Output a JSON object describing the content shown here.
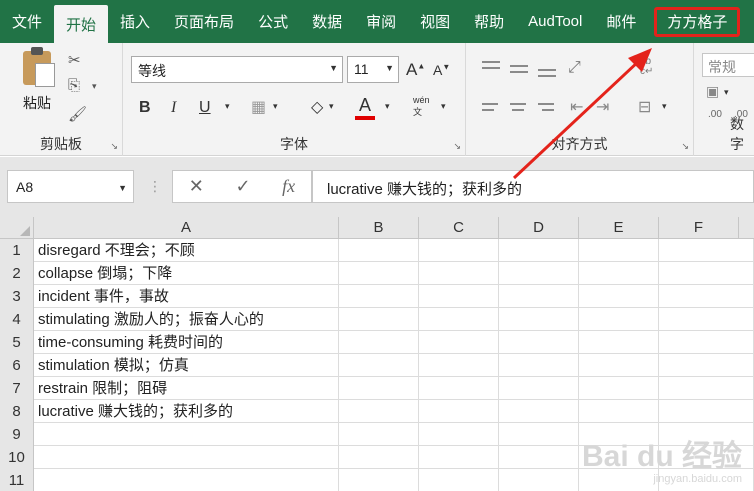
{
  "menu": {
    "tabs": [
      "文件",
      "开始",
      "插入",
      "页面布局",
      "公式",
      "数据",
      "审阅",
      "视图",
      "帮助",
      "AudTool",
      "邮件",
      "方方格子"
    ],
    "active_index": 1,
    "highlight_index": 11
  },
  "ribbon": {
    "clipboard": {
      "paste_label": "粘贴",
      "group_label": "剪贴板"
    },
    "font": {
      "font_name": "等线",
      "font_size": "11",
      "bold": "B",
      "italic": "I",
      "underline": "U",
      "font_color_glyph": "A",
      "phonetic": "wén",
      "grow": "A",
      "shrink": "A",
      "group_label": "字体"
    },
    "alignment": {
      "group_label": "对齐方式",
      "wrap_glyph": "ab\nc"
    },
    "number": {
      "format": "常规",
      "group_label": "数字",
      "decimal_inc": ".00",
      "decimal_dec": ".00"
    }
  },
  "formula_bar": {
    "name_box": "A8",
    "cancel_icon": "✕",
    "enter_icon": "✓",
    "fx_icon": "fx",
    "content": "lucrative 赚大钱的；获利多的"
  },
  "grid": {
    "columns": [
      "A",
      "B",
      "C",
      "D",
      "E",
      "F"
    ],
    "rows": [
      {
        "num": "1",
        "a": "disregard 不理会；不顾"
      },
      {
        "num": "2",
        "a": "collapse 倒塌；下降"
      },
      {
        "num": "3",
        "a": "incident 事件，事故"
      },
      {
        "num": "4",
        "a": "stimulating 激励人的；振奋人心的"
      },
      {
        "num": "5",
        "a": "time-consuming 耗费时间的"
      },
      {
        "num": "6",
        "a": "stimulation 模拟；仿真"
      },
      {
        "num": "7",
        "a": "restrain 限制；阻碍"
      },
      {
        "num": "8",
        "a": "lucrative 赚大钱的；获利多的"
      },
      {
        "num": "9",
        "a": ""
      },
      {
        "num": "10",
        "a": ""
      },
      {
        "num": "11",
        "a": ""
      }
    ]
  },
  "watermark": {
    "main": "Bai du 经验",
    "sub": "jingyan.baidu.com"
  },
  "colors": {
    "accent": "#217346",
    "annotation": "#e4231b",
    "font_color_bar": "#e00000"
  }
}
